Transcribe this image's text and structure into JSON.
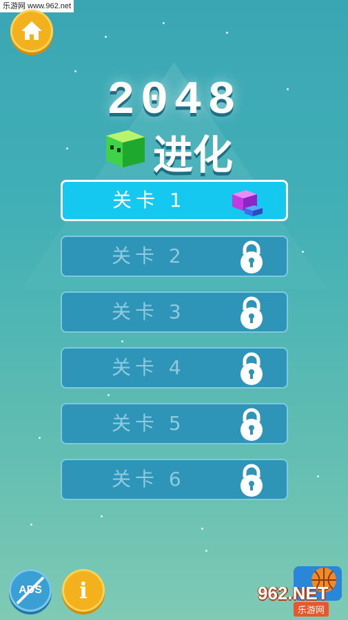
{
  "watermark_top": "乐游网 www.962.net",
  "logo": {
    "number": "2048",
    "subtitle": "进化"
  },
  "levels": [
    {
      "label": "关卡 1",
      "state": "unlocked",
      "icon": "purple-cube-icon"
    },
    {
      "label": "关卡 2",
      "state": "locked",
      "icon": "lock-icon"
    },
    {
      "label": "关卡 3",
      "state": "locked",
      "icon": "lock-icon"
    },
    {
      "label": "关卡 4",
      "state": "locked",
      "icon": "lock-icon"
    },
    {
      "label": "关卡 5",
      "state": "locked",
      "icon": "lock-icon"
    },
    {
      "label": "关卡 6",
      "state": "locked",
      "icon": "lock-icon"
    }
  ],
  "buttons": {
    "home_icon": "home-icon",
    "ads_label": "ADS",
    "info_label": "i"
  },
  "watermark_bottom": {
    "main": "962.NET",
    "sub": "乐游网"
  },
  "colors": {
    "accent": "#f3b21d",
    "level_active": "#14c8f0",
    "level_locked": "#2f95b8",
    "ads": "#3a9fd2"
  }
}
